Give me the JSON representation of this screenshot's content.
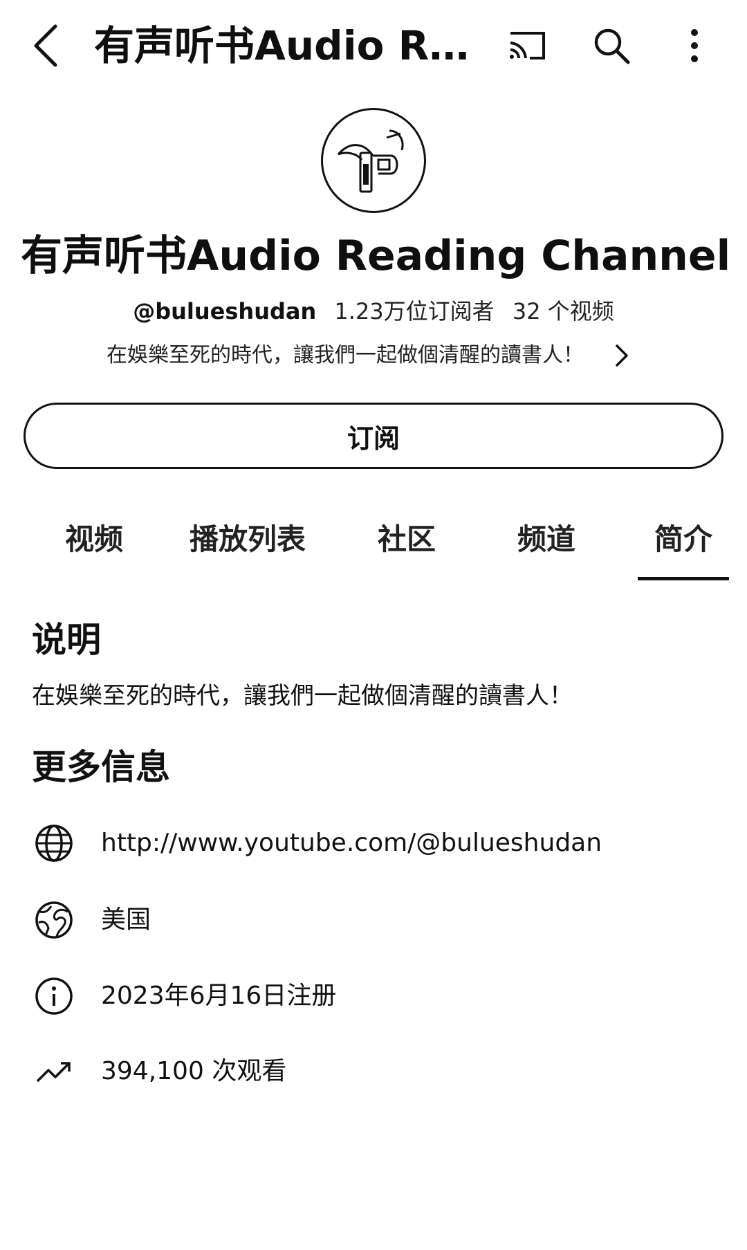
{
  "header": {
    "title": "有声听书Audio Rea...",
    "back_icon": "back-arrow-icon",
    "cast_icon": "cast-icon",
    "search_icon": "search-icon",
    "more_icon": "more-vertical-icon"
  },
  "channel": {
    "name": "有声听书Audio Reading Channel",
    "handle": "@bulueshudan",
    "subscribers": "1.23万位订阅者",
    "videos": "32 个视频",
    "tagline": "在娛樂至死的時代，讓我們一起做個清醒的讀書人！"
  },
  "subscribe_label": "订阅",
  "tabs": [
    {
      "label": "视频",
      "active": false
    },
    {
      "label": "播放列表",
      "active": false
    },
    {
      "label": "社区",
      "active": false
    },
    {
      "label": "频道",
      "active": false
    },
    {
      "label": "简介",
      "active": true
    }
  ],
  "about": {
    "description_heading": "说明",
    "description": "在娛樂至死的時代，讓我們一起做個清醒的讀書人！",
    "more_info_heading": "更多信息",
    "info": [
      {
        "icon": "globe-icon",
        "text": "http://www.youtube.com/@bulueshudan"
      },
      {
        "icon": "earth-icon",
        "text": "美国"
      },
      {
        "icon": "info-icon",
        "text": "2023年6月16日注册"
      },
      {
        "icon": "trending-icon",
        "text": "394,100 次观看"
      }
    ]
  }
}
